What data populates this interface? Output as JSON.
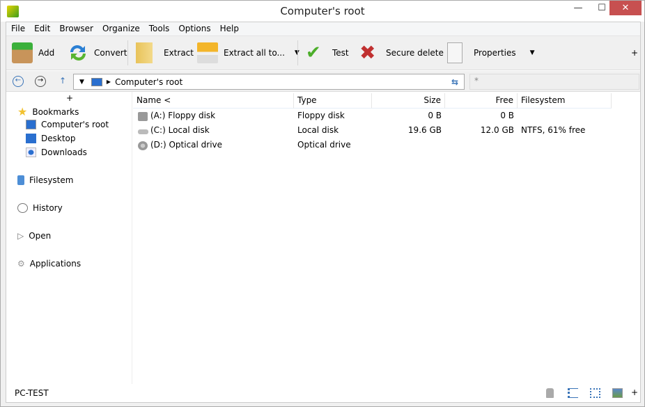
{
  "window": {
    "title": "Computer's root",
    "minimize": "—",
    "maximize": "☐",
    "close": "✕"
  },
  "menu": [
    "File",
    "Edit",
    "Browser",
    "Organize",
    "Tools",
    "Options",
    "Help"
  ],
  "toolbar": {
    "add": "Add",
    "convert": "Convert",
    "extract": "Extract",
    "extract_all": "Extract all to...",
    "test": "Test",
    "secure_delete": "Secure delete",
    "properties": "Properties",
    "more": "+"
  },
  "address": {
    "path": "Computer's root",
    "filter_placeholder": "*"
  },
  "sidebar": {
    "expand": "+",
    "bookmarks": "Bookmarks",
    "bookmark_items": [
      "Computer's root",
      "Desktop",
      "Downloads"
    ],
    "sections": [
      "Filesystem",
      "History",
      "Open",
      "Applications"
    ]
  },
  "columns": [
    "Name <",
    "Type",
    "Size",
    "Free",
    "Filesystem"
  ],
  "rows": [
    {
      "name": "(A:) Floppy disk",
      "type": "Floppy disk",
      "size": "0 B",
      "free": "0 B",
      "fs": ""
    },
    {
      "name": "(C:) Local disk",
      "type": "Local disk",
      "size": "19.6 GB",
      "free": "12.0 GB",
      "fs": "NTFS, 61% free"
    },
    {
      "name": "(D:) Optical drive",
      "type": "Optical drive",
      "size": "",
      "free": "",
      "fs": ""
    }
  ],
  "status": {
    "computer": "PC-TEST",
    "more": "+"
  }
}
